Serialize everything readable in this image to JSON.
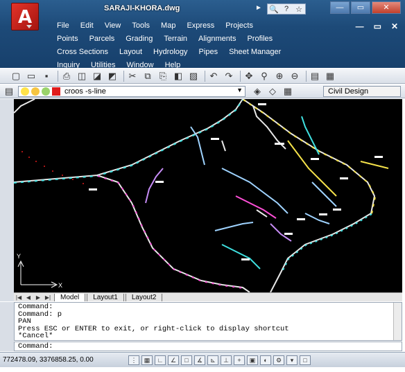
{
  "window": {
    "title": "SARAJI-KHORA.dwg",
    "quick_icons": [
      "search-icon",
      "help-icon",
      "star-icon"
    ],
    "controls": [
      "minimize-icon",
      "maximize-icon",
      "close-icon"
    ],
    "control_glyphs": [
      "—",
      "▭",
      "✕"
    ]
  },
  "app_logo": "A",
  "menus": {
    "row1": [
      "File",
      "Edit",
      "View",
      "Tools",
      "Map",
      "Express",
      "Projects"
    ],
    "row2": [
      "Points",
      "Parcels",
      "Grading",
      "Terrain",
      "Alignments",
      "Profiles"
    ],
    "row3": [
      "Cross Sections",
      "Layout",
      "Hydrology",
      "Pipes",
      "Sheet Manager"
    ],
    "row4": [
      "Inquiry",
      "Utilities",
      "Window",
      "Help"
    ]
  },
  "doc_controls": [
    "—",
    "▭",
    "✕"
  ],
  "toolbar": {
    "icons": [
      "new-icon",
      "open-icon",
      "save-icon",
      "print-icon",
      "preview-icon",
      "publish-icon",
      "3d-print-icon",
      "cut-icon",
      "copy-icon",
      "paste-icon",
      "match-icon",
      "block-icon",
      "undo-icon",
      "redo-icon",
      "pan-icon",
      "zoom-realtime-icon",
      "zoom-window-icon",
      "zoom-previous-icon",
      "properties-icon",
      "design-center-icon"
    ],
    "glyphs": [
      "▢",
      "▭",
      "▪",
      "⎙",
      "◫",
      "◪",
      "◩",
      "✂",
      "⧉",
      "⎘",
      "◧",
      "▨",
      "↶",
      "↷",
      "✥",
      "⚲",
      "⊕",
      "⊖",
      "▤",
      "▦"
    ]
  },
  "layer": {
    "current": "croos -s-line",
    "color": "#e01b1b",
    "workspace": "Civil Design"
  },
  "layout_tabs": [
    "Model",
    "Layout1",
    "Layout2"
  ],
  "command_history": [
    "Command:",
    "Command: p",
    "PAN",
    "Press ESC or ENTER to exit, or right-click to display shortcut",
    "*Cancel*"
  ],
  "command_prompt": "Command:",
  "status": {
    "coordinates": "772478.09, 3376858.25, 0.00",
    "toggles": [
      "snap-icon",
      "grid-icon",
      "ortho-icon",
      "polar-icon",
      "osnap-icon",
      "otrack-icon",
      "ducs-icon",
      "dyn-icon",
      "lwt-icon",
      "model-icon",
      "annotation-icon",
      "workspace-icon",
      "toolbar-lock-icon",
      "clean-screen-icon"
    ]
  },
  "ucs": {
    "x_label": "X",
    "y_label": "Y"
  }
}
